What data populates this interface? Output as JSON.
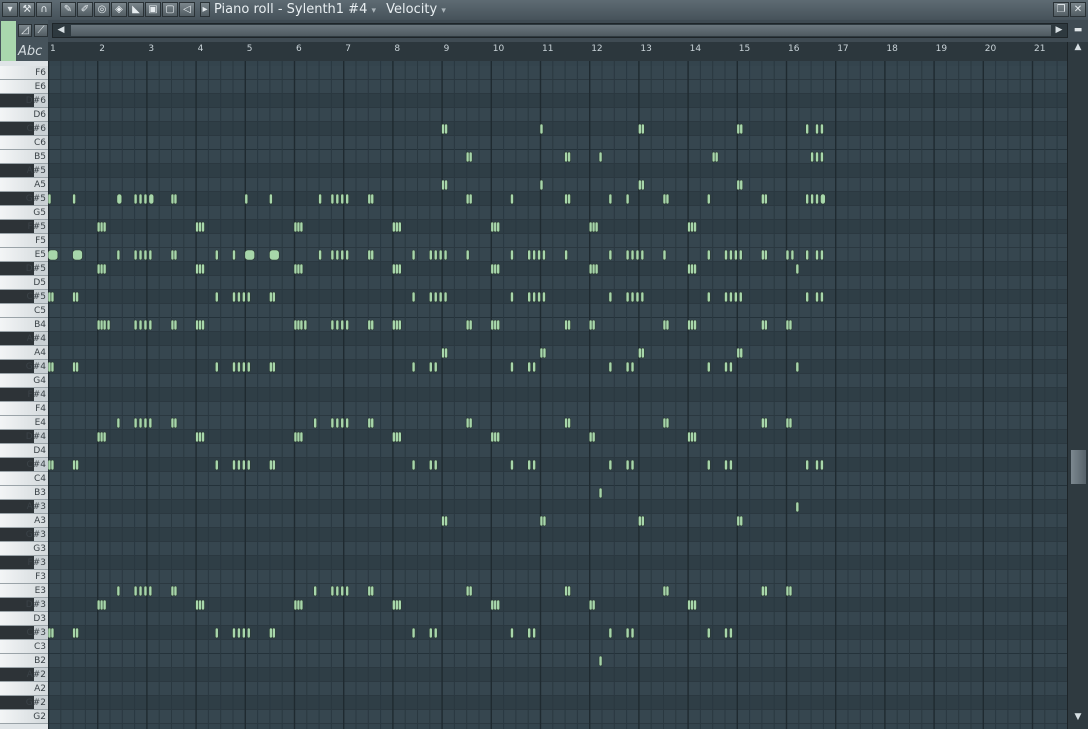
{
  "window": {
    "title": "Piano roll - Sylenth1 #4",
    "target_label": "Velocity",
    "snap_icon": "magnet-icon"
  },
  "toolbar": {
    "tools": [
      "draw-icon",
      "paint-icon",
      "delete-icon",
      "mute-icon",
      "slice-icon",
      "select-icon",
      "zoom-icon",
      "playback-icon"
    ],
    "text_label": "Abc"
  },
  "ruler": {
    "bars": [
      "1",
      "2",
      "3",
      "4",
      "5",
      "6",
      "7",
      "8",
      "9",
      "10",
      "11",
      "12",
      "13",
      "14",
      "15",
      "16",
      "17",
      "18",
      "19",
      "20",
      "21"
    ]
  },
  "keyboard": {
    "keys": [
      "F6",
      "E6",
      "D#6",
      "D6",
      "C#6",
      "C6",
      "B5",
      "A#5",
      "A5",
      "G#5",
      "G5",
      "F#5",
      "F5",
      "E5",
      "D#5",
      "D5",
      "C#5",
      "C5",
      "B4",
      "A#4",
      "A4",
      "G#4",
      "G4",
      "F#4",
      "F4",
      "E4",
      "D#4",
      "D4",
      "C#4",
      "C4",
      "B3",
      "A#3",
      "A3",
      "G#3",
      "G3",
      "F#3",
      "F3",
      "E3",
      "D#3",
      "D3",
      "C#3",
      "C3",
      "B2",
      "A#2",
      "A2",
      "G#2",
      "G2"
    ]
  },
  "colors": {
    "note": "#a7d6aa",
    "grid_bg": "#34444d",
    "accent": "#a9d7ad"
  },
  "notes": [
    {
      "key": "C#6",
      "starts": [
        9.0,
        9.06,
        11.0,
        13.0,
        13.06,
        15.0,
        15.06,
        16.4,
        16.6,
        16.7
      ]
    },
    {
      "key": "B5",
      "starts": [
        9.5,
        9.56,
        11.5,
        11.56,
        12.2,
        14.5,
        14.56,
        16.5,
        16.6,
        16.7
      ]
    },
    {
      "key": "A5",
      "starts": [
        9.0,
        9.06,
        11.0,
        13.0,
        13.06,
        15.0,
        15.06
      ]
    },
    {
      "key": "G#5",
      "starts": [
        1.0,
        1.5,
        2.4,
        2.75,
        2.85,
        2.95,
        3.05,
        3.5,
        3.56,
        5.0,
        5.5,
        6.5,
        6.75,
        6.85,
        6.95,
        7.05,
        7.5,
        7.56,
        9.5,
        9.56,
        10.4,
        11.5,
        11.56,
        12.4,
        12.75,
        13.5,
        13.56,
        14.4,
        15.5,
        15.56,
        16.4,
        16.5,
        16.6,
        16.7
      ],
      "wide": [
        [
          2.4,
          0.1
        ],
        [
          3.05,
          0.1
        ],
        [
          11.0,
          0.1
        ],
        [
          16.7,
          0.1
        ]
      ]
    },
    {
      "key": "F#5",
      "starts": [
        2.0,
        2.06,
        2.12,
        4.0,
        4.06,
        4.12,
        6.0,
        6.06,
        6.12,
        8.0,
        8.06,
        8.12,
        10.0,
        10.06,
        10.12,
        12.0,
        12.06,
        12.12,
        14.0,
        14.06,
        14.12
      ]
    },
    {
      "key": "E5",
      "starts": [
        1.0,
        1.5,
        2.4,
        2.75,
        2.85,
        2.95,
        3.05,
        3.5,
        3.56,
        4.4,
        4.75,
        5.0,
        5.5,
        6.5,
        6.75,
        6.85,
        6.95,
        7.05,
        7.5,
        7.56,
        8.4,
        8.75,
        8.85,
        8.95,
        9.05,
        9.5,
        10.4,
        10.75,
        10.85,
        10.95,
        11.05,
        11.5,
        12.4,
        12.75,
        12.85,
        12.95,
        13.05,
        13.5,
        14.4,
        14.75,
        14.85,
        14.95,
        15.05,
        15.5,
        15.56,
        16.0,
        16.1,
        16.4,
        16.6,
        16.7
      ],
      "wide": [
        [
          1.0,
          0.2
        ],
        [
          1.5,
          0.2
        ],
        [
          5.0,
          0.2
        ],
        [
          5.5,
          0.2
        ]
      ]
    },
    {
      "key": "D#5",
      "starts": [
        2.0,
        2.06,
        2.12,
        4.0,
        4.06,
        4.12,
        6.0,
        6.06,
        6.12,
        8.0,
        8.06,
        8.12,
        10.0,
        10.06,
        10.12,
        12.0,
        12.06,
        12.12,
        14.0,
        14.06,
        14.12,
        16.2
      ]
    },
    {
      "key": "C#5",
      "starts": [
        1.0,
        1.06,
        1.5,
        1.56,
        4.4,
        4.75,
        4.85,
        4.95,
        5.05,
        5.5,
        5.56,
        8.4,
        8.75,
        8.85,
        8.95,
        9.05,
        10.4,
        10.75,
        10.85,
        10.95,
        11.05,
        12.4,
        12.75,
        12.85,
        12.95,
        13.05,
        14.4,
        14.75,
        14.85,
        14.95,
        15.05,
        16.4,
        16.6,
        16.7
      ]
    },
    {
      "key": "B4",
      "starts": [
        2.0,
        2.06,
        2.12,
        2.2,
        2.75,
        2.85,
        2.95,
        3.05,
        3.5,
        3.56,
        4.0,
        4.06,
        4.12,
        6.0,
        6.06,
        6.12,
        6.2,
        6.75,
        6.85,
        6.95,
        7.05,
        7.5,
        7.56,
        8.0,
        8.06,
        8.12,
        9.5,
        9.56,
        10.0,
        10.06,
        10.12,
        11.5,
        11.56,
        12.0,
        12.06,
        13.5,
        13.56,
        14.0,
        14.06,
        14.12,
        15.5,
        15.56,
        16.0,
        16.06
      ]
    },
    {
      "key": "A4",
      "starts": [
        9.0,
        9.06,
        11.0,
        11.06,
        13.0,
        13.06,
        15.0,
        15.06
      ]
    },
    {
      "key": "G#4",
      "starts": [
        1.0,
        1.06,
        1.5,
        1.56,
        4.4,
        4.75,
        4.85,
        4.95,
        5.05,
        5.5,
        5.56,
        8.4,
        8.75,
        8.85,
        10.4,
        10.75,
        10.85,
        12.4,
        12.75,
        12.85,
        14.4,
        14.75,
        14.85,
        16.2
      ]
    },
    {
      "key": "E4",
      "starts": [
        2.4,
        2.75,
        2.85,
        2.95,
        3.05,
        3.5,
        3.56,
        6.4,
        6.75,
        6.85,
        6.95,
        7.05,
        7.5,
        7.56,
        9.5,
        9.56,
        11.5,
        11.56,
        13.5,
        13.56,
        15.5,
        15.56,
        16.0,
        16.06
      ]
    },
    {
      "key": "D#4",
      "starts": [
        2.0,
        2.06,
        2.12,
        4.0,
        4.06,
        4.12,
        6.0,
        6.06,
        6.12,
        8.0,
        8.06,
        8.12,
        10.0,
        10.06,
        10.12,
        12.0,
        12.06,
        14.0,
        14.06,
        14.12
      ]
    },
    {
      "key": "C#4",
      "starts": [
        1.0,
        1.06,
        1.5,
        1.56,
        4.4,
        4.75,
        4.85,
        4.95,
        5.05,
        5.5,
        5.56,
        8.4,
        8.75,
        8.85,
        10.4,
        10.75,
        10.85,
        12.4,
        12.75,
        12.85,
        14.4,
        14.75,
        14.85,
        16.4,
        16.6,
        16.7
      ]
    },
    {
      "key": "B3",
      "starts": [
        12.2
      ]
    },
    {
      "key": "A#3",
      "starts": [
        16.2
      ]
    },
    {
      "key": "A3",
      "starts": [
        9.0,
        9.06,
        11.0,
        11.06,
        13.0,
        13.06,
        15.0,
        15.06
      ]
    },
    {
      "key": "E3",
      "starts": [
        2.4,
        2.75,
        2.85,
        2.95,
        3.05,
        3.5,
        3.56,
        6.4,
        6.75,
        6.85,
        6.95,
        7.05,
        7.5,
        7.56,
        9.5,
        9.56,
        11.5,
        11.56,
        13.5,
        13.56,
        15.5,
        15.56,
        16.0,
        16.06
      ]
    },
    {
      "key": "D#3",
      "starts": [
        2.0,
        2.06,
        2.12,
        4.0,
        4.06,
        4.12,
        6.0,
        6.06,
        6.12,
        8.0,
        8.06,
        8.12,
        10.0,
        10.06,
        10.12,
        12.0,
        12.06,
        14.0,
        14.06,
        14.12
      ]
    },
    {
      "key": "C#3",
      "starts": [
        1.0,
        1.06,
        1.5,
        1.56,
        4.4,
        4.75,
        4.85,
        4.95,
        5.05,
        5.5,
        5.56,
        8.4,
        8.75,
        8.85,
        10.4,
        10.75,
        10.85,
        12.4,
        12.75,
        12.85,
        14.4,
        14.75,
        14.85
      ]
    },
    {
      "key": "B2",
      "starts": [
        12.2
      ]
    }
  ]
}
